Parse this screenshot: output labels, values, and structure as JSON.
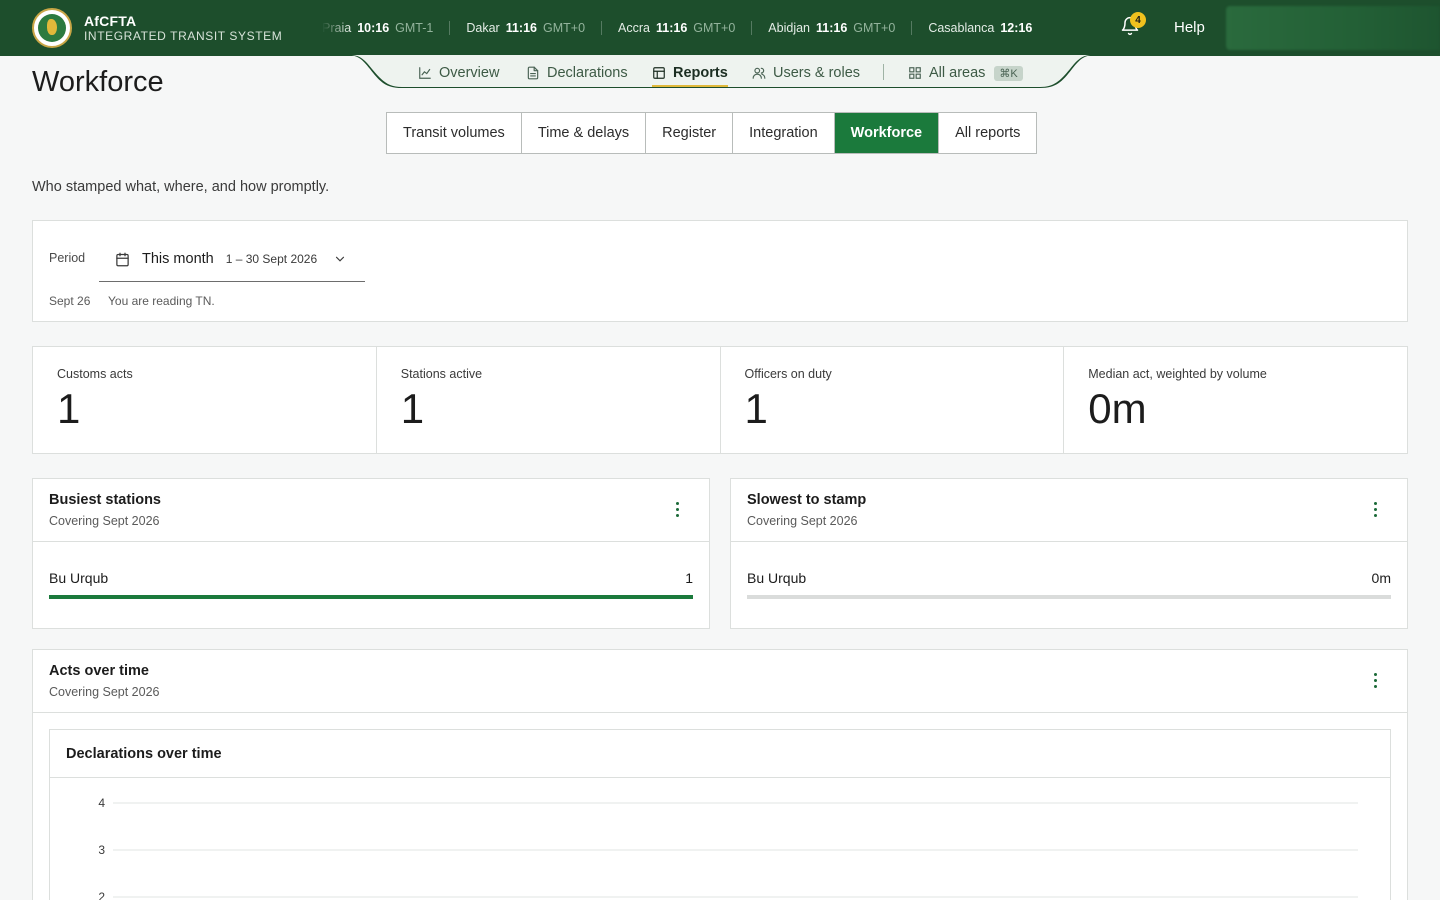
{
  "header": {
    "brand_name": "AfCFTA",
    "brand_sub": "INTEGRATED TRANSIT SYSTEM",
    "clocks": [
      {
        "city": "Praia",
        "time": "10:16",
        "tz": "GMT-1"
      },
      {
        "city": "Dakar",
        "time": "11:16",
        "tz": "GMT+0"
      },
      {
        "city": "Accra",
        "time": "11:16",
        "tz": "GMT+0"
      },
      {
        "city": "Abidjan",
        "time": "11:16",
        "tz": "GMT+0"
      },
      {
        "city": "Casablanca",
        "time": "12:16",
        "tz": ""
      }
    ],
    "notification_count": "4",
    "help_label": "Help"
  },
  "nav": {
    "overview": "Overview",
    "declarations": "Declarations",
    "reports": "Reports",
    "users_roles": "Users & roles",
    "all_areas": "All areas",
    "shortcut": "⌘K"
  },
  "page": {
    "title": "Workforce",
    "lead": "Who stamped what, where, and how promptly."
  },
  "report_tabs": [
    "Transit volumes",
    "Time & delays",
    "Register",
    "Integration",
    "Workforce",
    "All reports"
  ],
  "period": {
    "label": "Period",
    "selected": "This month",
    "range": "1 – 30 Sept 2026",
    "foot_date": "Sept 26",
    "foot_note": "You are reading TN."
  },
  "kpis": [
    {
      "label": "Customs acts",
      "value": "1"
    },
    {
      "label": "Stations active",
      "value": "1"
    },
    {
      "label": "Officers on duty",
      "value": "1"
    },
    {
      "label": "Median act, weighted by volume",
      "value": "0m"
    }
  ],
  "busiest": {
    "title": "Busiest stations",
    "subtitle": "Covering Sept 2026",
    "rows": [
      {
        "name": "Bu Urqub",
        "value": "1",
        "fill": 1.0
      }
    ]
  },
  "slowest": {
    "title": "Slowest to stamp",
    "subtitle": "Covering Sept 2026",
    "rows": [
      {
        "name": "Bu Urqub",
        "value": "0m",
        "fill": 0.0
      }
    ]
  },
  "acts": {
    "title": "Acts over time",
    "subtitle": "Covering Sept 2026",
    "chart_title": "Declarations over time"
  },
  "chart_data": {
    "type": "line",
    "title": "Declarations over time",
    "xlabel": "",
    "ylabel": "",
    "y_ticks": [
      4,
      3,
      2
    ],
    "ylim": [
      0,
      4
    ],
    "grid": true,
    "series": []
  },
  "colors": {
    "brand_green": "#1d4e2c",
    "accent_green": "#1b7a3c",
    "gold": "#e0b93a",
    "badge_yellow": "#f0c11e"
  }
}
